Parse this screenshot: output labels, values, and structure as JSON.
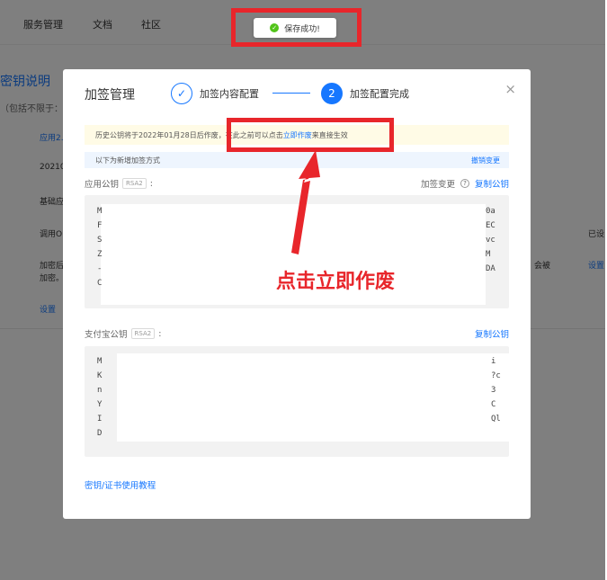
{
  "background": {
    "nav": [
      "服务管理",
      "文档",
      "社区"
    ],
    "title": "密钥说明",
    "subtitle": "（包括不限于：",
    "rows": [
      {
        "text": "应用2.",
        "link": true
      },
      {
        "text": "20210",
        "link": false
      },
      {
        "text": "基础应",
        "link": false
      },
      {
        "text": "调用O",
        "link": false
      },
      {
        "text": "加密后",
        "link": false
      },
      {
        "text": "加密。",
        "link": false
      },
      {
        "text": "设置",
        "link": true
      }
    ],
    "right": {
      "configured": "已设",
      "settings_link": "设置",
      "mid_text": "会被"
    }
  },
  "toast": {
    "text": "保存成功!"
  },
  "modal": {
    "title": "加签管理",
    "step1": {
      "label": "加签内容配置"
    },
    "step2": {
      "number": "2",
      "label": "加签配置完成"
    },
    "warning": {
      "prefix": "历史公钥将于2022年01月28日后作废，在此之前可以点击",
      "link": "立即作废",
      "suffix": "来直接生效"
    },
    "info": {
      "text": "以下为新增加签方式",
      "revoke": "撤销变更"
    },
    "app_key": {
      "label": "应用公钥",
      "badge": "RSA2",
      "change": "加签变更",
      "copy": "复制公钥",
      "left_chars": [
        "M",
        "F",
        "S",
        "Z",
        "-",
        "C"
      ],
      "right_chars": [
        "0a",
        "EC",
        "vc",
        "M",
        "DA"
      ]
    },
    "alipay_key": {
      "label": "支付宝公钥",
      "badge": "RSA2",
      "copy": "复制公钥",
      "left_chars": [
        "M",
        "K",
        "n",
        "Y",
        "I",
        "D"
      ],
      "right_chars": [
        "i",
        "?c",
        "3",
        "C",
        "Ql"
      ]
    },
    "bottom_link": "密钥/证书使用教程"
  },
  "annotation": {
    "text": "点击立即作废"
  },
  "colors": {
    "accent": "#1677ff",
    "highlight": "#e8262b",
    "success": "#52c41a"
  }
}
